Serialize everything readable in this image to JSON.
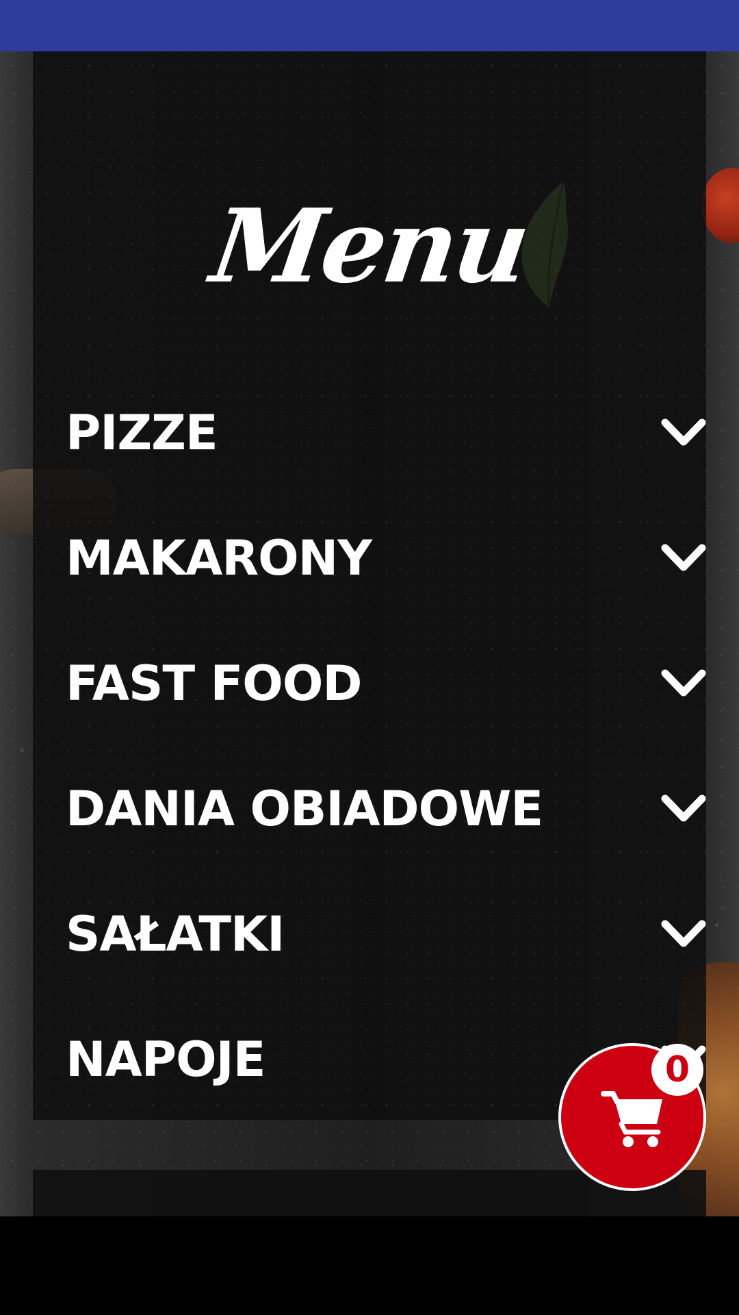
{
  "menu": {
    "title": "Menu",
    "categories": [
      {
        "label": "PIZZE",
        "icon": "chevron-down-icon"
      },
      {
        "label": "MAKARONY",
        "icon": "chevron-down-icon"
      },
      {
        "label": "FAST FOOD",
        "icon": "chevron-down-icon"
      },
      {
        "label": "DANIA OBIADOWE",
        "icon": "chevron-down-icon"
      },
      {
        "label": "SAŁATKI",
        "icon": "chevron-down-icon"
      },
      {
        "label": "NAPOJE",
        "icon": "chevron-down-icon"
      }
    ]
  },
  "cart": {
    "icon": "cart-icon",
    "count": "0"
  },
  "colors": {
    "status_bar": "#2e3d9c",
    "cart": "#cc0011",
    "text": "#ffffff",
    "card": "#0f0f0f"
  }
}
